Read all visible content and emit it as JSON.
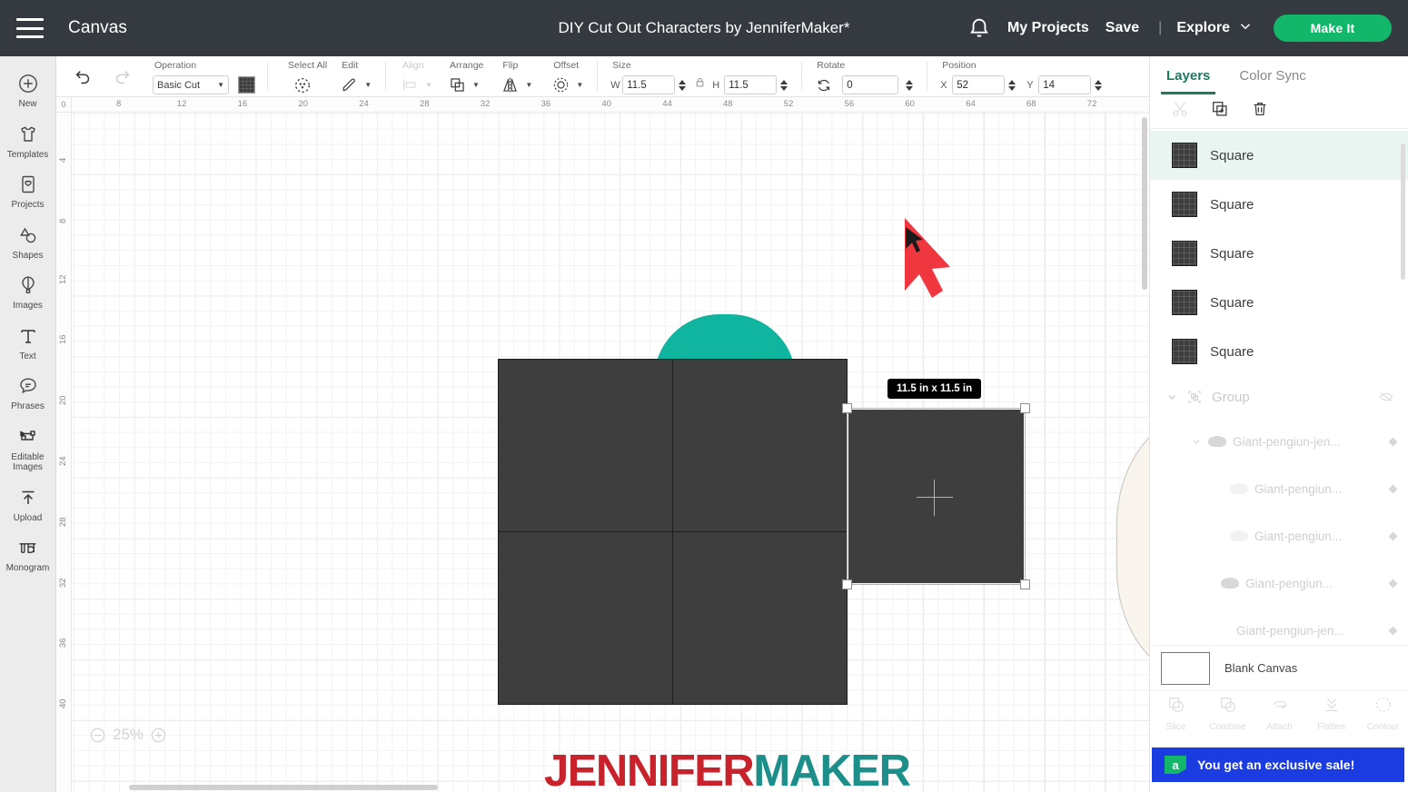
{
  "header": {
    "menu_icon": "hamburger-icon",
    "canvas_label": "Canvas",
    "document_title": "DIY Cut Out Characters by JenniferMaker*",
    "notifications_icon": "bell-icon",
    "my_projects": "My Projects",
    "save": "Save",
    "separator": "|",
    "explore": "Explore",
    "explore_chevron": "chevron-down-icon",
    "make_it": "Make It",
    "bg_color": "#353a41",
    "accent_green": "#12b76a"
  },
  "sidebar": {
    "items": [
      {
        "label": "New",
        "icon": "plus-circle-icon"
      },
      {
        "label": "Templates",
        "icon": "tshirt-icon"
      },
      {
        "label": "Projects",
        "icon": "card-heart-icon"
      },
      {
        "label": "Shapes",
        "icon": "shapes-icon"
      },
      {
        "label": "Images",
        "icon": "hot-air-balloon-icon"
      },
      {
        "label": "Text",
        "icon": "text-t-icon"
      },
      {
        "label": "Phrases",
        "icon": "speech-bubble-icon"
      },
      {
        "label": "Editable Images",
        "icon": "editable-images-icon"
      },
      {
        "label": "Upload",
        "icon": "upload-arrow-icon"
      },
      {
        "label": "Monogram",
        "icon": "monogram-icon"
      }
    ]
  },
  "toolbar": {
    "undo": "undo-icon",
    "redo": "redo-icon",
    "operation": {
      "caption": "Operation",
      "value": "Basic Cut",
      "color": "#3d3d3d"
    },
    "select_all": {
      "caption": "Select All",
      "icon": "select-all-icon"
    },
    "edit": {
      "caption": "Edit",
      "icon": "pencil-icon"
    },
    "align": {
      "caption": "Align",
      "icon": "align-icon",
      "disabled": true
    },
    "arrange": {
      "caption": "Arrange",
      "icon": "arrange-icon"
    },
    "flip": {
      "caption": "Flip",
      "icon": "flip-icon"
    },
    "offset": {
      "caption": "Offset",
      "icon": "offset-icon"
    },
    "size": {
      "caption": "Size",
      "w_label": "W",
      "w_value": "11.5",
      "h_label": "H",
      "h_value": "11.5",
      "lock_icon": "lock-icon"
    },
    "rotate": {
      "caption": "Rotate",
      "icon": "rotate-icon",
      "value": "0"
    },
    "position": {
      "caption": "Position",
      "x_label": "X",
      "x_value": "52",
      "y_label": "Y",
      "y_value": "14"
    }
  },
  "canvas": {
    "ruler_h_ticks": [
      "8",
      "12",
      "16",
      "20",
      "24",
      "28",
      "32",
      "36",
      "40",
      "44",
      "48",
      "52",
      "56",
      "60",
      "64",
      "68",
      "72"
    ],
    "ruler_v_ticks": [
      "4",
      "8",
      "12",
      "16",
      "20",
      "24",
      "28",
      "32",
      "36",
      "40"
    ],
    "ruler_origin": "0",
    "size_tooltip": "11.5  in x 11.5  in",
    "zoom_level": "25%",
    "zoom_out_icon": "minus-circle-icon",
    "zoom_in_icon": "plus-circle-icon",
    "cursor_icon": "red-arrow-cursor",
    "watermark_part1": "JENNIFER",
    "watermark_part2": "MAKER",
    "watermark_color1": "#c8232c",
    "watermark_color2": "#1d8f8a",
    "square_fill": "#3e3e3e",
    "teal_shape_color": "#10b5a0",
    "belly_color": "#faf4ef"
  },
  "right_panel": {
    "tabs": [
      {
        "label": "Layers",
        "active": true
      },
      {
        "label": "Color Sync",
        "active": false
      }
    ],
    "tools": [
      {
        "name": "cut-icon",
        "disabled": true
      },
      {
        "name": "duplicate-icon",
        "disabled": false
      },
      {
        "name": "trash-icon",
        "disabled": false
      }
    ],
    "layers": [
      {
        "label": "Square",
        "selected": true
      },
      {
        "label": "Square",
        "selected": false
      },
      {
        "label": "Square",
        "selected": false
      },
      {
        "label": "Square",
        "selected": false
      },
      {
        "label": "Square",
        "selected": false
      }
    ],
    "group": {
      "label": "Group",
      "visibility_icon": "eye-hidden-icon",
      "expand_icon": "chevron-down-icon"
    },
    "group_children": [
      {
        "label": "Giant-pengiun-jen...",
        "indent": 1,
        "has_chevron": true,
        "thumb": "blob"
      },
      {
        "label": "Giant-pengiun...",
        "indent": 2,
        "has_chevron": false,
        "thumb": "faint"
      },
      {
        "label": "Giant-pengiun...",
        "indent": 2,
        "has_chevron": false,
        "thumb": "faint"
      },
      {
        "label": "Giant-pengiun...",
        "indent": 2,
        "has_chevron": false,
        "thumb": "blob"
      },
      {
        "label": "Giant-pengiun-jen...",
        "indent": 1,
        "has_chevron": false,
        "thumb": "none"
      }
    ],
    "blank_canvas": "Blank Canvas",
    "bottom_tools": [
      {
        "label": "Slice",
        "icon": "slice-icon",
        "disabled": true
      },
      {
        "label": "Combine",
        "icon": "combine-icon",
        "disabled": true
      },
      {
        "label": "Attach",
        "icon": "attach-icon",
        "disabled": true
      },
      {
        "label": "Flatten",
        "icon": "flatten-icon",
        "disabled": true
      },
      {
        "label": "Contour",
        "icon": "contour-icon",
        "disabled": true
      }
    ],
    "promo": {
      "badge": "a",
      "text": "You get an exclusive sale!",
      "bg_color": "#1a3ce0"
    }
  }
}
